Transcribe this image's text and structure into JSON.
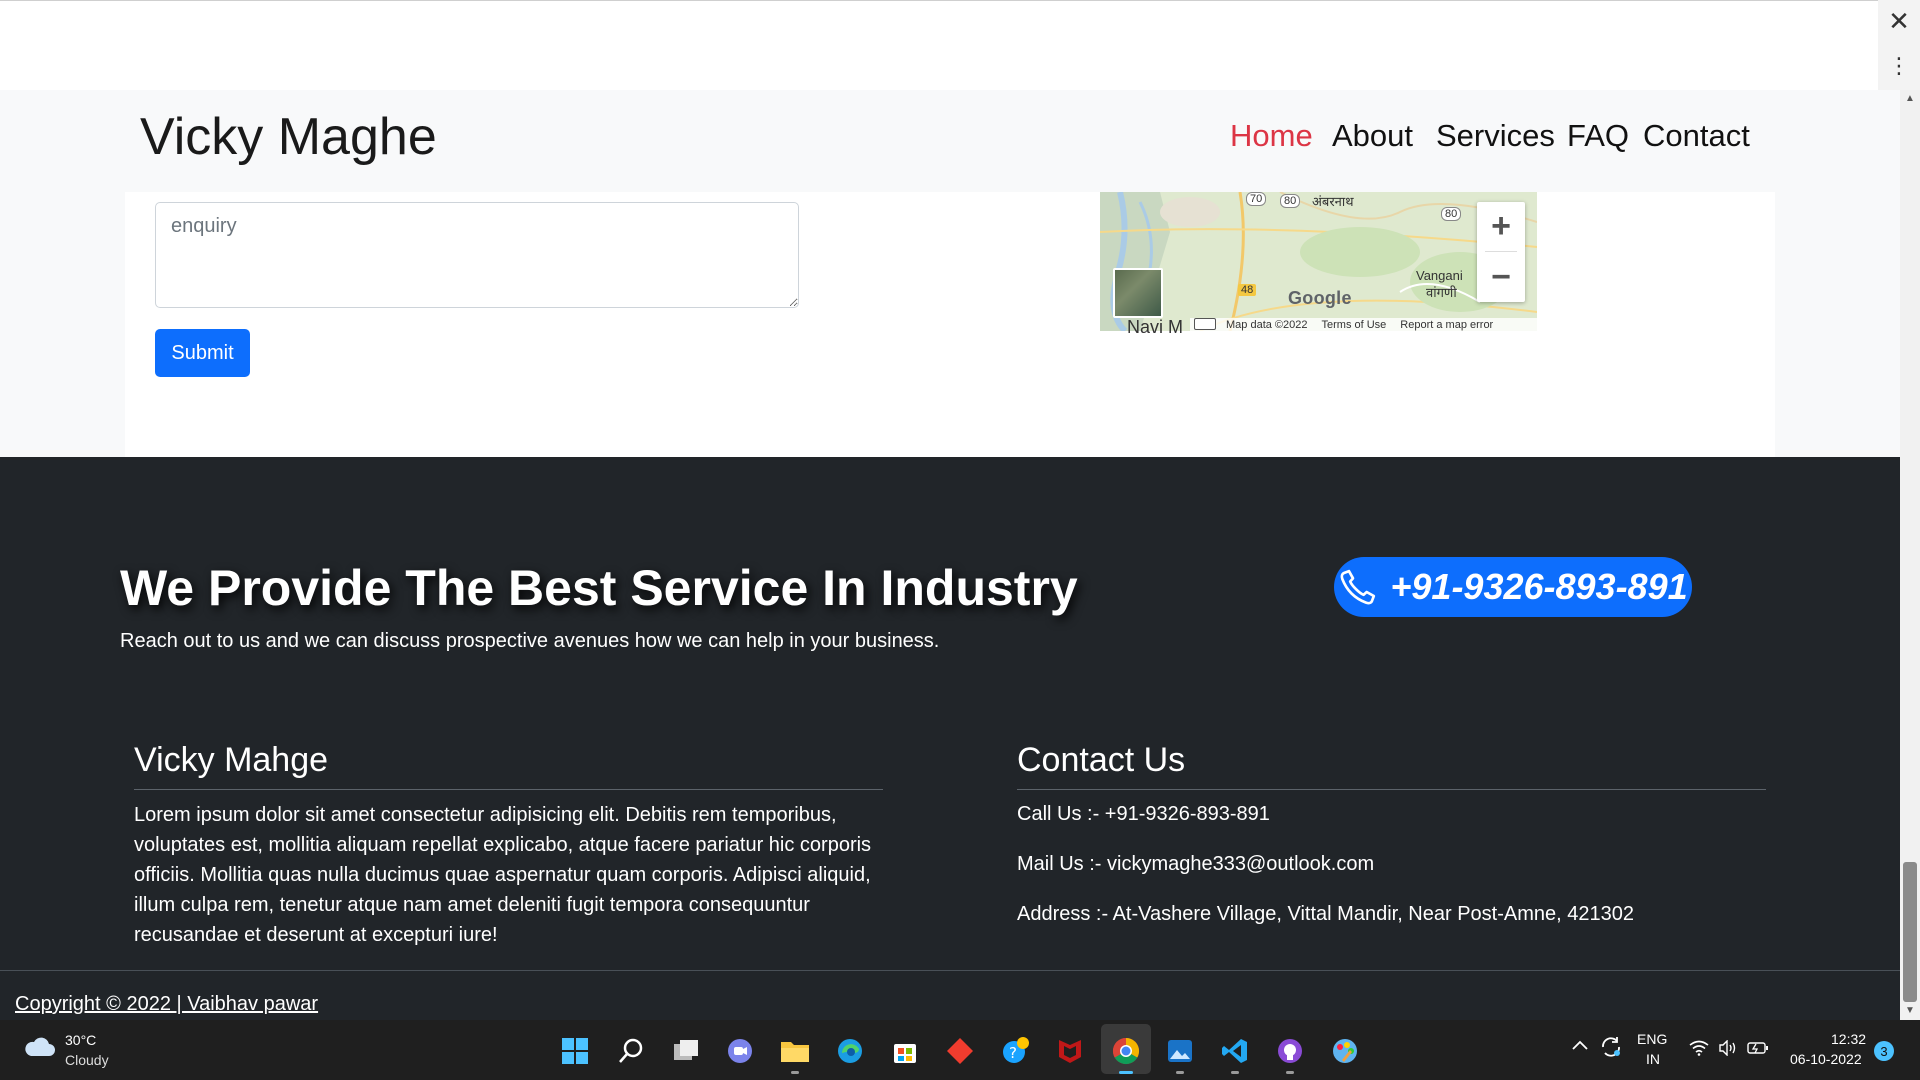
{
  "browser": {
    "close_icon": "✕",
    "menu_icon": "⋮"
  },
  "navbar": {
    "brand": "Vicky Maghe",
    "links": [
      "Home",
      "About",
      "Services",
      "FAQ",
      "Contact"
    ],
    "active_color": "#dc3545"
  },
  "form": {
    "enquiry_placeholder": "enquiry",
    "submit_label": "Submit"
  },
  "map": {
    "zoom_in": "+",
    "zoom_out": "−",
    "labels": {
      "ambernath": "Ambernath",
      "ambernath_devanagari": "अंबरनाथ",
      "vangani": "Vangani",
      "vangani_devanagari": "वांगणी",
      "navi": "Navi M",
      "road_80": "80",
      "road_48": "48",
      "road_70": "70"
    },
    "google_logo": "Google",
    "attribution": [
      "Map data ©2022",
      "Terms of Use",
      "Report a map error"
    ]
  },
  "footer": {
    "cta_title": "We Provide The Best Service In Industry",
    "cta_subtitle": "Reach out to us and we can discuss prospective avenues how we can help in your business.",
    "phone": "+91-9326-893-891",
    "about_title": "Vicky Mahge",
    "about_text": "Lorem ipsum dolor sit amet consectetur adipisicing elit. Debitis rem temporibus, voluptates est, mollitia aliquam repellat explicabo, atque facere pariatur hic corporis officiis. Mollitia quas nulla ducimus quae aspernatur quam corporis. Adipisci aliquid, illum culpa rem, tenetur atque nam amet deleniti fugit tempora consequuntur recusandae et deserunt at excepturi iure!",
    "contact_title": "Contact Us",
    "call": "Call Us :- +91-9326-893-891",
    "mail": "Mail Us :- vickymaghe333@outlook.com",
    "address": "Address :- At-Vashere Village, Vittal Mandir, Near Post-Amne, 421302",
    "copyright": "Copyright © 2022 | Vaibhav pawar"
  },
  "taskbar": {
    "weather_temp": "30°C",
    "weather_desc": "Cloudy",
    "apps": [
      "windows-start",
      "search",
      "task-view",
      "teams-chat",
      "file-explorer",
      "edge",
      "store",
      "git-diamond",
      "skype",
      "mcafee",
      "chrome",
      "photos",
      "vscode",
      "github",
      "paint"
    ],
    "lang1": "ENG",
    "lang2": "IN",
    "time": "12:32",
    "date": "06-10-2022",
    "notifications": "3"
  }
}
